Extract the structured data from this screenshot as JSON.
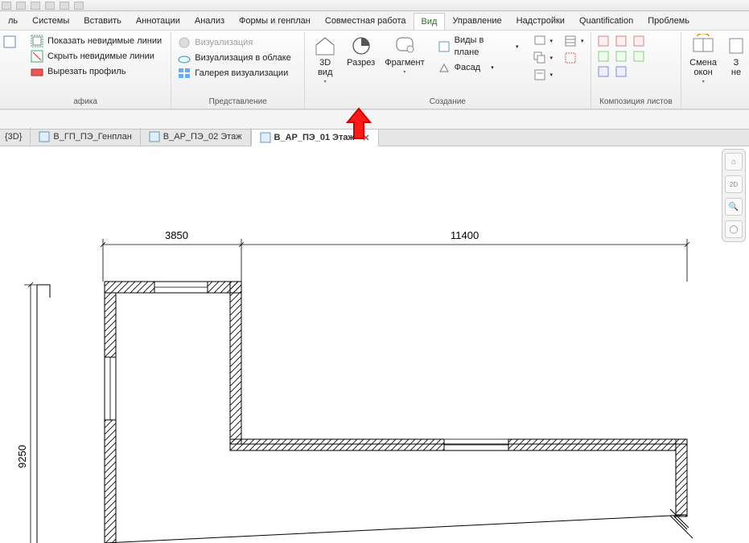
{
  "menus": [
    "ль",
    "Системы",
    "Вставить",
    "Аннотации",
    "Анализ",
    "Формы и генплан",
    "Совместная работа",
    "Вид",
    "Управление",
    "Надстройки",
    "Quantification",
    "Проблемь"
  ],
  "active_menu": "Вид",
  "panels": {
    "grafika": {
      "label": "афика",
      "items": [
        "Показать невидимые линии",
        "Скрыть невидимые линии",
        "Вырезать профиль"
      ]
    },
    "present": {
      "label": "Представление",
      "items": [
        "Визуализация",
        "Визуализация  в облаке",
        "Галерея  визуализации"
      ]
    },
    "create": {
      "label": "Создание",
      "view3d": "3D\nвид",
      "section": "Разрез",
      "fragment": "Фрагмент",
      "plans": "Виды в плане",
      "facade": "Фасад"
    },
    "sheets": {
      "label": "Композиция листов"
    },
    "windows": {
      "label": "Смена\nокон",
      "col2": "З\nне"
    }
  },
  "tabs": [
    {
      "label": "{3D}",
      "icon": false
    },
    {
      "label": "В_ГП_ПЭ_Генплан",
      "icon": true
    },
    {
      "label": "В_АР_ПЭ_02 Этаж",
      "icon": true
    },
    {
      "label": "В_АР_ПЭ_01 Этаж",
      "icon": true,
      "active": true,
      "closable": true
    }
  ],
  "dims": {
    "top1": "3850",
    "top2": "11400",
    "left": "9250"
  }
}
